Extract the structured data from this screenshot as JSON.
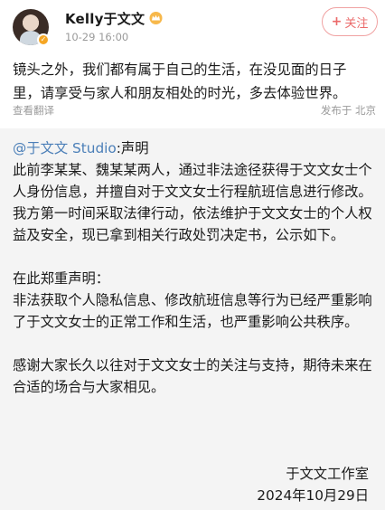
{
  "post": {
    "username": "Kelly于文文",
    "timestamp": "10-29 16:00",
    "follow_label": "关注",
    "follow_plus": "+",
    "text_line1": "镜头之外，我们都有属于自己的生活，在没见面的日子",
    "text_line2": "里，请享受与家人和朋友相处的时光，多去体验世界。",
    "translate_label": "查看翻译",
    "location": "发布于 北京",
    "icons": {
      "badge": "verified-badge-icon",
      "crown": "crown-icon"
    },
    "colors": {
      "follow": "#eb6a6a",
      "mention": "#4b7fb8",
      "meta": "#9a9a9a"
    }
  },
  "quote": {
    "mention": "@于文文 Studio",
    "mention_suffix": ":声明",
    "para1": "此前李某某、魏某某两人，通过非法途径获得于文文女士个人身份信息，并擅自对于文文女士行程航班信息进行修改。我方第一时间采取法律行动，依法维护于文文女士的个人权益及安全，现已拿到相关行政处罚决定书，公示如下。",
    "para2": "在此郑重声明：",
    "para3": "非法获取个人隐私信息、修改航班信息等行为已经严重影响了于文文女士的正常工作和生活，也严重影响公共秩序。",
    "para4": "感谢大家长久以往对于文文女士的关注与支持，期待未来在合适的场合与大家相见。",
    "signature_name": "于文文工作室",
    "signature_date": "2024年10月29日"
  }
}
